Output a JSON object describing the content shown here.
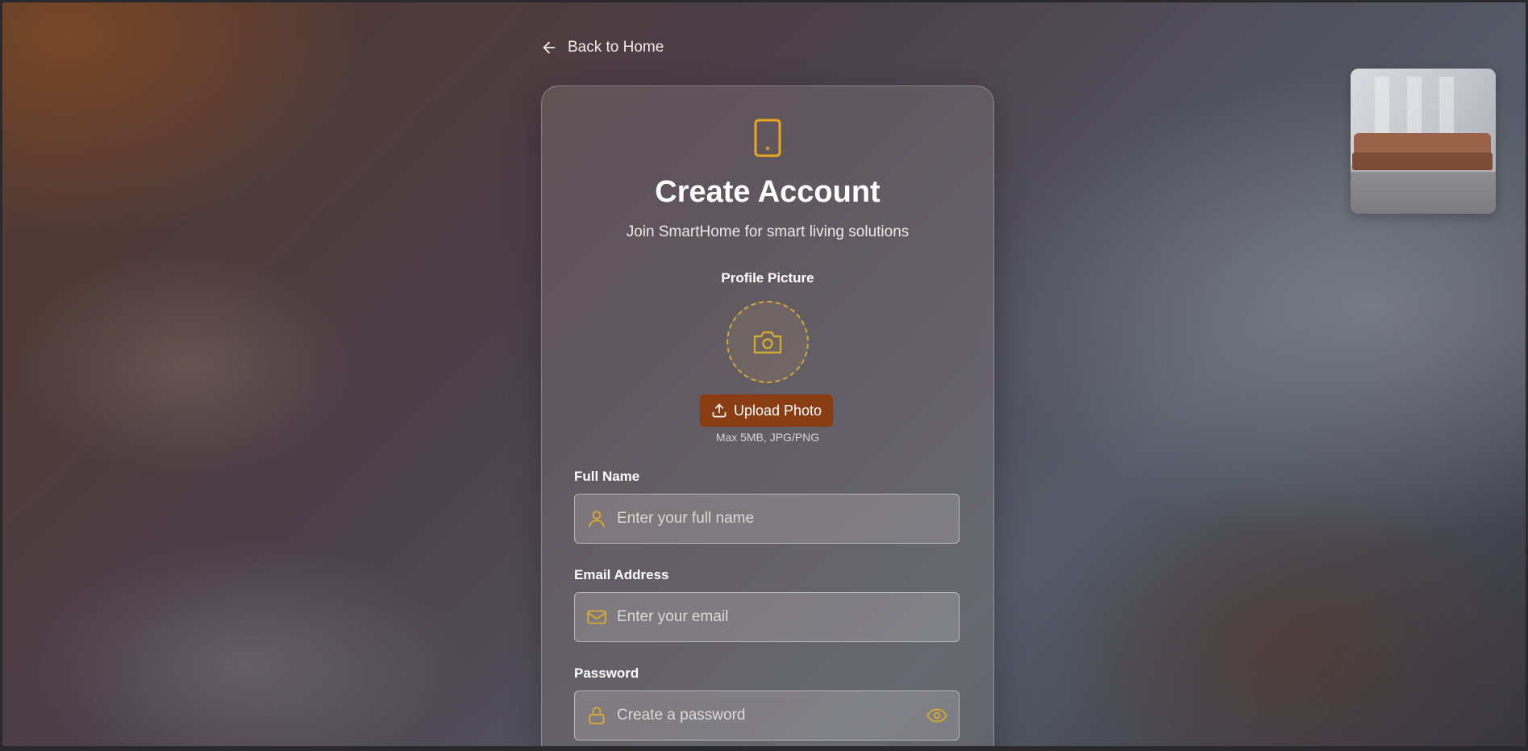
{
  "colors": {
    "accent": "#d4a933",
    "upload_button": "#8a3d12",
    "text_primary": "#ffffff"
  },
  "nav": {
    "back_label": "Back to Home",
    "back_icon": "arrow-left-icon"
  },
  "header": {
    "icon": "smartphone-icon",
    "title": "Create Account",
    "subtitle": "Join SmartHome for smart living solutions"
  },
  "profile_picture": {
    "label": "Profile Picture",
    "placeholder_icon": "camera-icon",
    "upload_label": "Upload Photo",
    "upload_icon": "upload-icon",
    "hint": "Max 5MB, JPG/PNG"
  },
  "form": {
    "full_name": {
      "label": "Full Name",
      "placeholder": "Enter your full name",
      "value": "",
      "icon": "user-icon"
    },
    "email": {
      "label": "Email Address",
      "placeholder": "Enter your email",
      "value": "",
      "icon": "mail-icon"
    },
    "password": {
      "label": "Password",
      "placeholder": "Create a password",
      "value": "",
      "icon": "lock-icon",
      "toggle_icon": "eye-icon"
    }
  },
  "preview": {
    "icon": "sofa-room-image"
  }
}
